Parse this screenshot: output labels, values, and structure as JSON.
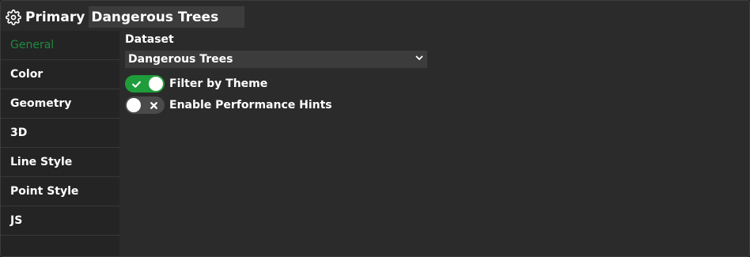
{
  "header": {
    "icon": "gear-icon",
    "label": "Primary",
    "name_value": "Dangerous Trees"
  },
  "sidebar": {
    "items": [
      {
        "label": "General",
        "active": true
      },
      {
        "label": "Color"
      },
      {
        "label": "Geometry"
      },
      {
        "label": "3D"
      },
      {
        "label": "Line Style"
      },
      {
        "label": "Point Style"
      },
      {
        "label": "JS"
      }
    ]
  },
  "general": {
    "dataset_label": "Dataset",
    "dataset_value": "Dangerous Trees",
    "filter_label": "Filter by Theme",
    "filter_on": true,
    "perf_label": "Enable Performance Hints",
    "perf_on": false
  },
  "colors": {
    "accent": "#1f9d3a",
    "active_tab": "#1e8a3e"
  }
}
